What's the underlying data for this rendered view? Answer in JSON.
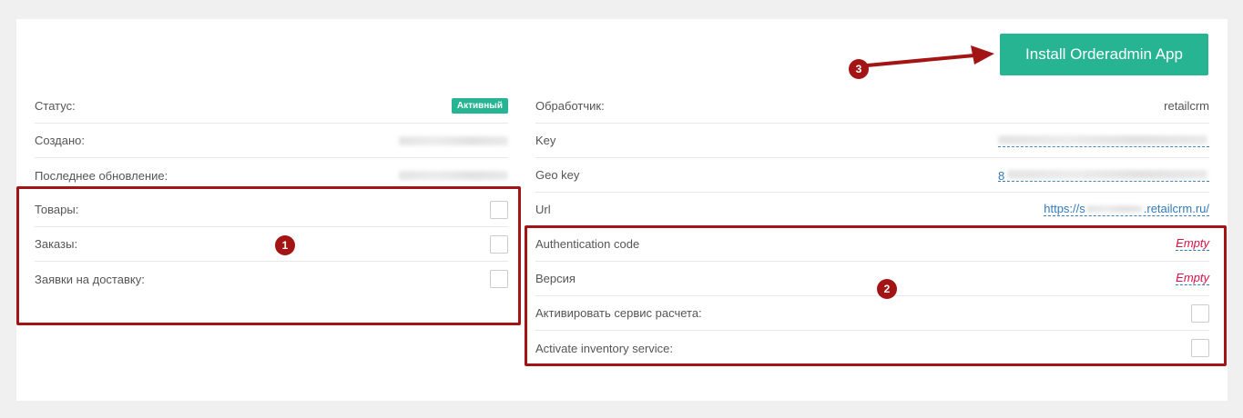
{
  "install_button": {
    "label": "Install Orderadmin App"
  },
  "left_panel": {
    "status": {
      "label": "Статус:",
      "badge": "Активный"
    },
    "created": {
      "label": "Создано:"
    },
    "updated": {
      "label": "Последнее обновление:"
    },
    "products": {
      "label": "Товары:"
    },
    "orders": {
      "label": "Заказы:"
    },
    "delivery_requests": {
      "label": "Заявки на доставку:"
    }
  },
  "right_panel": {
    "handler": {
      "label": "Обработчик:",
      "value": "retailcrm"
    },
    "key": {
      "label": "Key"
    },
    "geo_key": {
      "label": "Geo key",
      "value_prefix": "8"
    },
    "url": {
      "label": "Url",
      "value_prefix": "https://s",
      "value_suffix": ".retailcrm.ru/"
    },
    "auth_code": {
      "label": "Authentication code",
      "value": "Empty"
    },
    "version": {
      "label": "Версия",
      "value": "Empty"
    },
    "activate_calc": {
      "label": "Активировать сервис расчета:"
    },
    "activate_inventory": {
      "label": "Activate inventory service:"
    }
  },
  "annotations": {
    "marker1": "1",
    "marker2": "2",
    "marker3": "3"
  },
  "colors": {
    "accent": "#26b493",
    "annotation": "#a31515",
    "link": "#337ab7",
    "empty": "#dd1144"
  }
}
